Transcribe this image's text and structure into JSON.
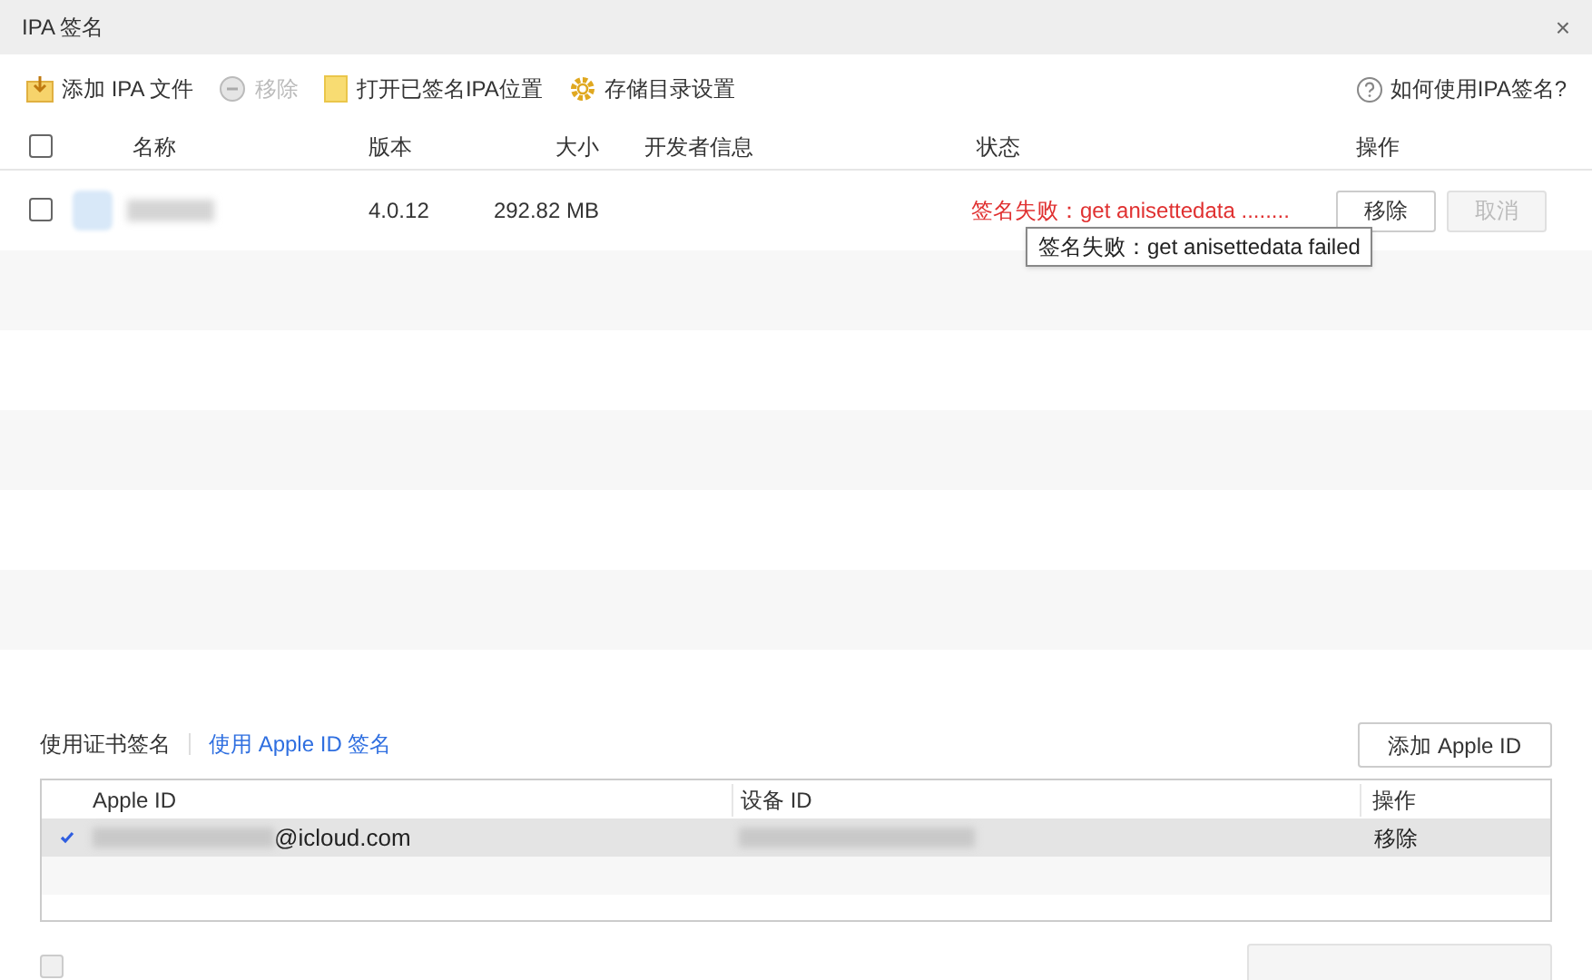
{
  "window": {
    "title": "IPA 签名",
    "close": "×"
  },
  "toolbar": {
    "items": [
      {
        "kind": "add",
        "label": "添加 IPA 文件",
        "disabled": false
      },
      {
        "kind": "remove",
        "label": "移除",
        "disabled": true
      },
      {
        "kind": "folder",
        "label": "打开已签名IPA位置",
        "disabled": false
      },
      {
        "kind": "gear",
        "label": "存储目录设置",
        "disabled": false
      }
    ],
    "help": "如何使用IPA签名?"
  },
  "table": {
    "select_all": false,
    "columns": [
      "名称",
      "版本",
      "大小",
      "开发者信息",
      "状态",
      "操作"
    ],
    "rows": [
      {
        "checked": false,
        "version": "4.0.12",
        "size": "292.82 MB",
        "status": "签名失败：get anisettedata ........",
        "tooltip": "签名失败：get anisettedata failed",
        "actions": [
          {
            "label": "移除",
            "disabled": false
          },
          {
            "label": "取消",
            "disabled": true
          }
        ]
      }
    ]
  },
  "sign_tabs": [
    {
      "label": "使用证书签名",
      "selected": false
    },
    {
      "label": "使用 Apple ID 签名",
      "selected": true
    }
  ],
  "add_apple_id": "添加 Apple ID",
  "accounts": {
    "columns": [
      "Apple ID",
      "设备 ID",
      "操作"
    ],
    "rows": [
      {
        "selected": true,
        "email_suffix": "@icloud.com",
        "action": "移除"
      }
    ]
  },
  "sync_checkbox": {
    "checked": false,
    "disabled": true
  }
}
